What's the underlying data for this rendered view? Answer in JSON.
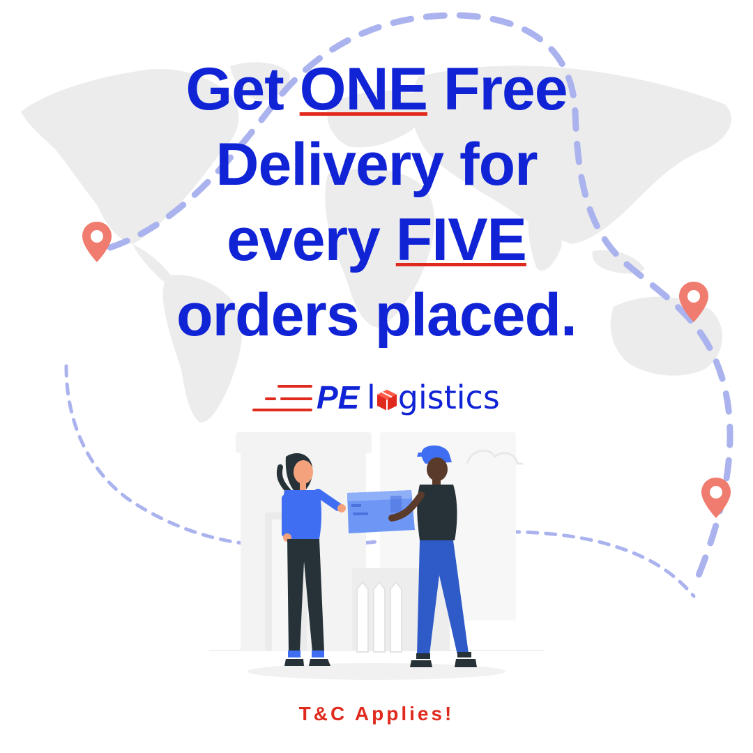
{
  "headline": {
    "line1_a": "Get ",
    "line1_em": "ONE",
    "line1_b": " Free",
    "line2": "Delivery for",
    "line3_a": "every ",
    "line3_em": "FIVE",
    "line4": "orders placed."
  },
  "brand": {
    "initials": "PE",
    "word_start": "l",
    "word_end": "gistics"
  },
  "footer": {
    "terms": "T&C Applies!"
  },
  "icons": {
    "pins": [
      "location-pin-icon",
      "location-pin-icon",
      "location-pin-icon"
    ],
    "logo_box": "package-box-icon",
    "logo_lines": "speed-lines-icon"
  },
  "colors": {
    "headline": "#1024d6",
    "accent": "#e02a1e",
    "route": "#aab3ee",
    "pin": "#ef7c6e",
    "map": "#ececec"
  }
}
